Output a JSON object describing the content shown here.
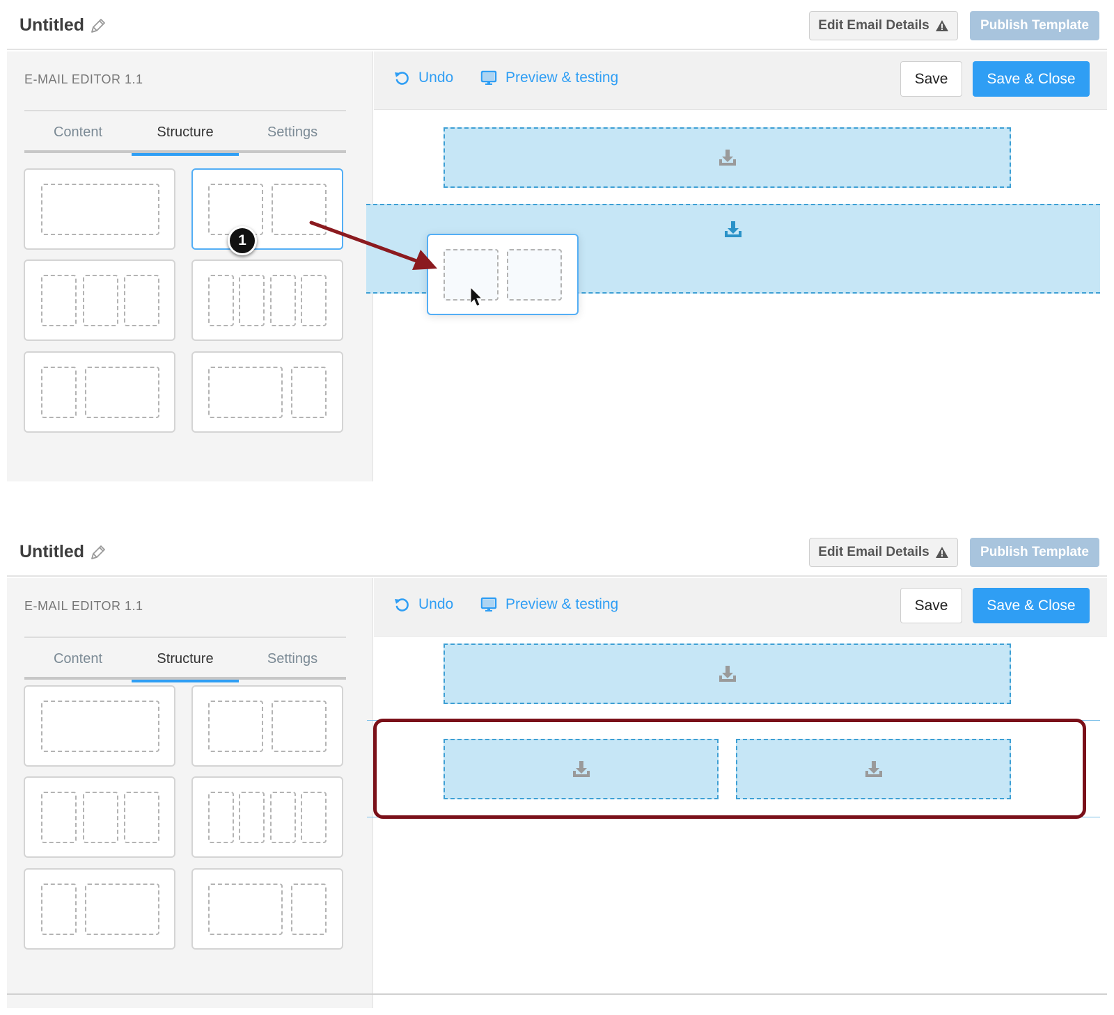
{
  "header": {
    "title": "Untitled",
    "edit_details_label": "Edit Email Details",
    "publish_label": "Publish Template"
  },
  "sidebar": {
    "title": "E-MAIL EDITOR 1.1",
    "tabs": [
      {
        "label": "Content"
      },
      {
        "label": "Structure",
        "active": true
      },
      {
        "label": "Settings"
      }
    ],
    "structure_layouts": [
      "1 column",
      "2 columns",
      "3 columns",
      "4 columns",
      "1/3 + 2/3",
      "2/3 + 1/3"
    ]
  },
  "toolbar": {
    "undo_label": "Undo",
    "preview_label": "Preview & testing",
    "save_label": "Save",
    "save_close_label": "Save & Close"
  },
  "annotation": {
    "step_number": "1",
    "arrow_color": "#8b1a1f",
    "highlight_color": "#7a1019"
  },
  "colors": {
    "accent": "#2f9ef4",
    "dropzone_fill": "#c6e6f6",
    "publish_disabled": "#a8c4dd"
  },
  "icons": [
    "pencil-icon",
    "warning-icon",
    "undo-icon",
    "monitor-icon",
    "download-icon",
    "cursor-icon"
  ]
}
